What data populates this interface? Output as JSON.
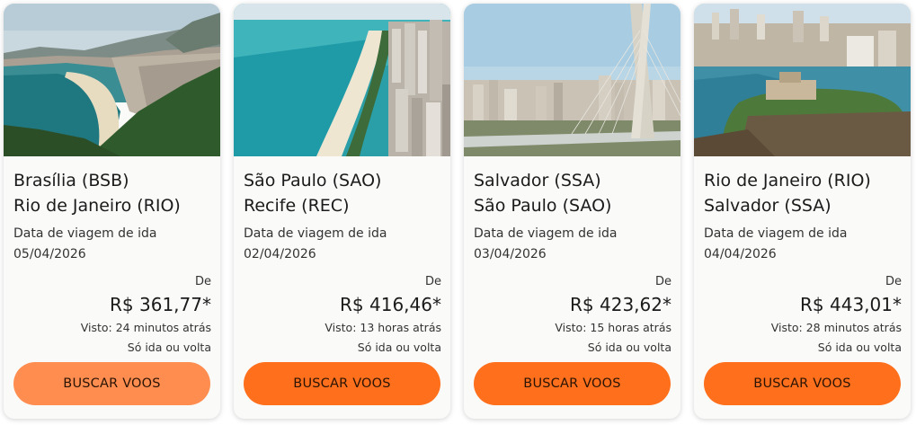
{
  "cards": [
    {
      "origin": "Brasília (BSB)",
      "destination": "Rio de Janeiro (RIO)",
      "date_label": "Data de viagem de ida",
      "date": "05/04/2026",
      "price_prefix": "De",
      "price": "R$ 361,77*",
      "seen": "Visto: 24 minutos atrás",
      "trip_type": "Só ida ou volta",
      "button_label": "BUSCAR VOOS"
    },
    {
      "origin": "São Paulo (SAO)",
      "destination": "Recife (REC)",
      "date_label": "Data de viagem de ida",
      "date": "02/04/2026",
      "price_prefix": "De",
      "price": "R$ 416,46*",
      "seen": "Visto: 13 horas atrás",
      "trip_type": "Só ida ou volta",
      "button_label": "BUSCAR VOOS"
    },
    {
      "origin": "Salvador (SSA)",
      "destination": "São Paulo (SAO)",
      "date_label": "Data de viagem de ida",
      "date": "03/04/2026",
      "price_prefix": "De",
      "price": "R$ 423,62*",
      "seen": "Visto: 15 horas atrás",
      "trip_type": "Só ida ou volta",
      "button_label": "BUSCAR VOOS"
    },
    {
      "origin": "Rio de Janeiro (RIO)",
      "destination": "Salvador (SSA)",
      "date_label": "Data de viagem de ida",
      "date": "04/04/2026",
      "price_prefix": "De",
      "price": "R$ 443,01*",
      "seen": "Visto: 28 minutos atrás",
      "trip_type": "Só ida ou volta",
      "button_label": "BUSCAR VOOS"
    }
  ],
  "colors": {
    "button_hover": "#ff8d4f",
    "button": "#ff6f1c",
    "card_bg": "#fafaf9"
  },
  "images": [
    "rio-de-janeiro-coastline-photo",
    "recife-beach-skyline-photo",
    "sao-paulo-bridge-photo",
    "salvador-bay-fort-photo"
  ]
}
